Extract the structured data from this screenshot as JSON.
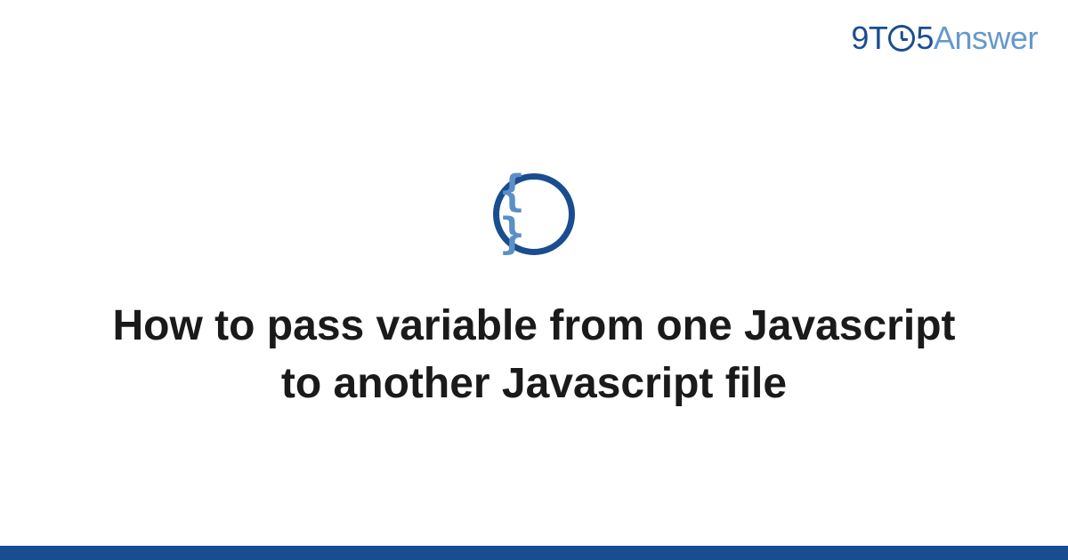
{
  "brand": {
    "part1": "9T",
    "part2": "5",
    "part3": "Answer"
  },
  "icon": {
    "glyph": "{ }"
  },
  "title": "How to pass variable from one Javascript to another Javascript file"
}
